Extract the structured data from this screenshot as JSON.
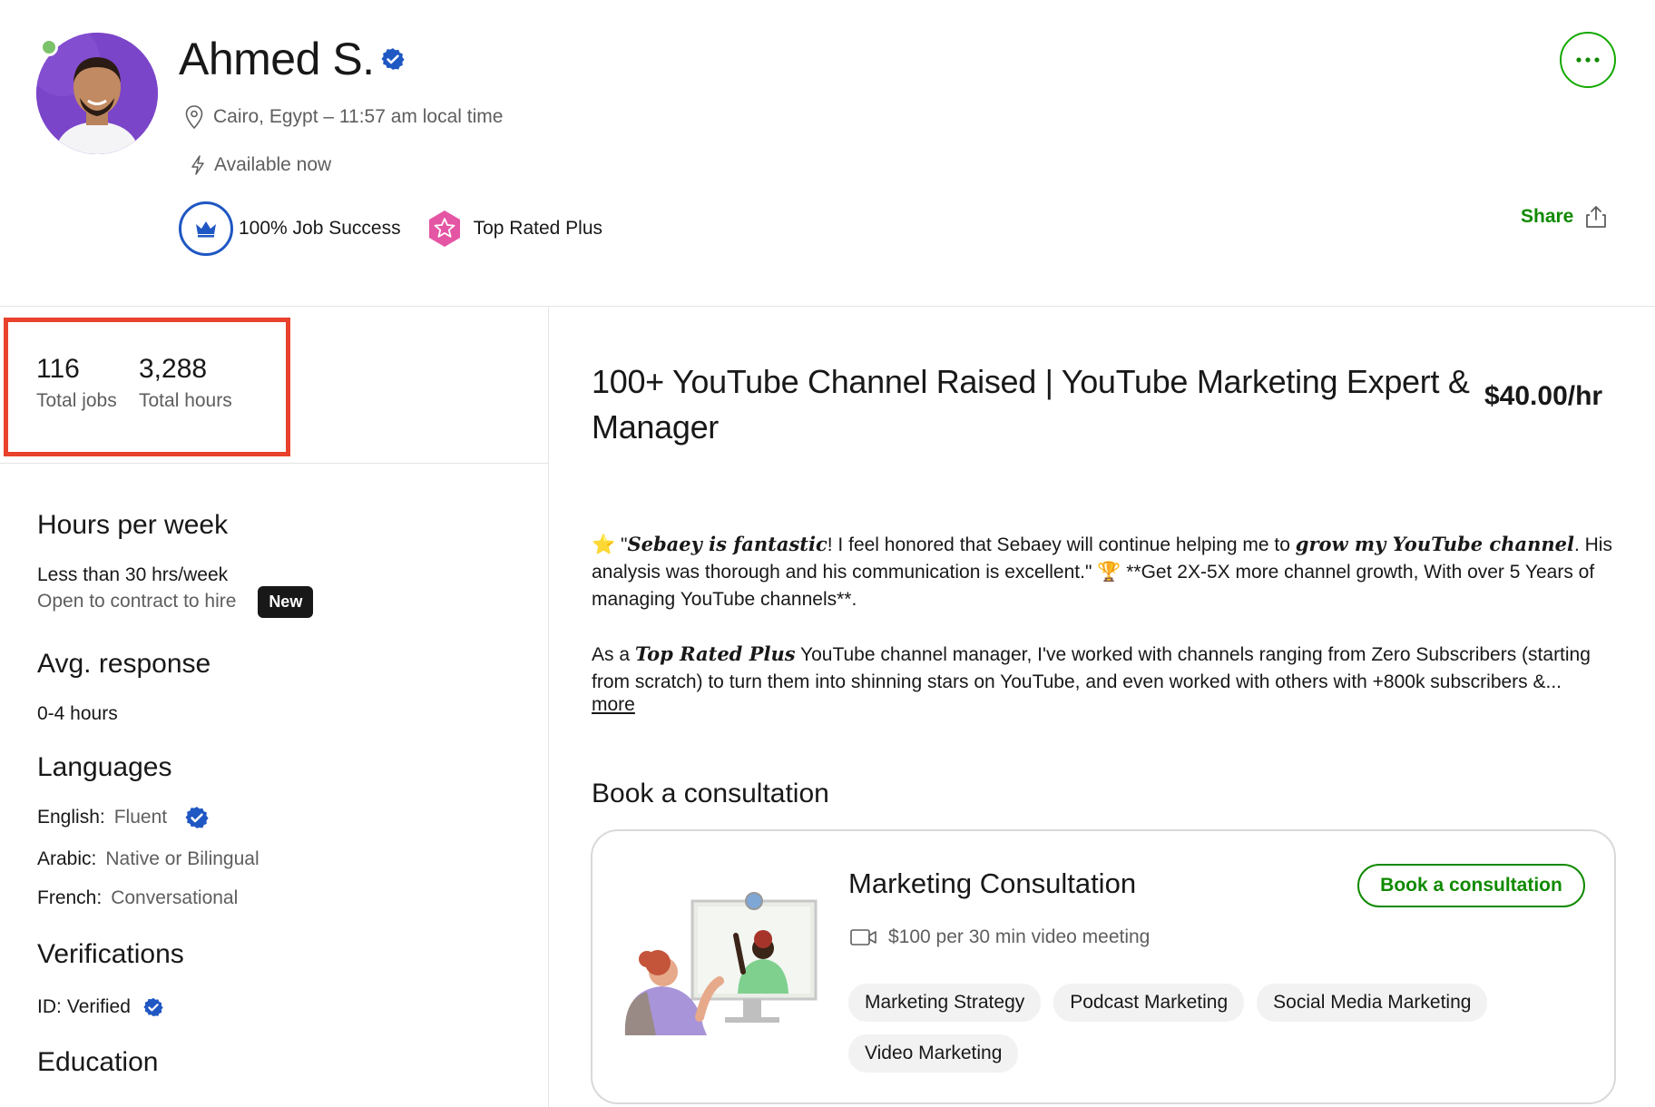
{
  "profile": {
    "name": "Ahmed S.",
    "location": "Cairo, Egypt – 11:57 am local time",
    "availability": "Available now",
    "job_success": "100% Job Success",
    "top_rated": "Top Rated Plus",
    "share_label": "Share"
  },
  "stats": {
    "jobs_value": "116",
    "jobs_label": "Total jobs",
    "hours_value": "3,288",
    "hours_label": "Total hours"
  },
  "sidebar": {
    "hours_heading": "Hours per week",
    "hours_value": "Less than 30 hrs/week",
    "contract_to_hire": "Open to contract to hire",
    "new_badge": "New",
    "response_heading": "Avg. response",
    "response_value": "0-4 hours",
    "languages_heading": "Languages",
    "languages": [
      {
        "name": "English:",
        "level": "Fluent"
      },
      {
        "name": "Arabic:",
        "level": "Native or Bilingual"
      },
      {
        "name": "French:",
        "level": "Conversational"
      }
    ],
    "verifications_heading": "Verifications",
    "id_label": "ID:",
    "id_value": "Verified",
    "education_heading": "Education"
  },
  "main": {
    "title": "100+ YouTube Channel Raised | YouTube Marketing Expert & Manager",
    "rate": "$40.00/hr",
    "desc_p1_a": " \"",
    "desc_p1_it1": "Sebaey is fantastic",
    "desc_p1_b": "! I feel honored that Sebaey will continue helping me to ",
    "desc_p1_it2": "grow my YouTube channel",
    "desc_p1_c": ". His analysis was thorough and his communication is excellent.\" ",
    "desc_p1_d": " **Get 2X-5X more channel growth, With over 5 Years of managing YouTube channels**.",
    "desc_p2_a": "As a ",
    "desc_p2_it": "Top Rated Plus",
    "desc_p2_b": " YouTube channel manager, I've worked with channels ranging from Zero Subscribers (starting from scratch) to turn them into shinning stars on YouTube, and even worked with others with +800k subscribers &...",
    "more_link": "more",
    "book_heading": "Book a consultation",
    "consultation": {
      "title": "Marketing Consultation",
      "meta": "$100 per 30 min video meeting",
      "button": "Book a consultation",
      "skills": [
        "Marketing Strategy",
        "Podcast Marketing",
        "Social Media Marketing",
        "Video Marketing"
      ]
    }
  },
  "colors": {
    "accent_green": "#108a00",
    "verified_blue": "#1f57c3",
    "highlight_red": "#e8412c"
  },
  "icons": [
    "verified-badge-icon",
    "location-pin-icon",
    "lightning-icon",
    "crown-icon",
    "star-badge-icon",
    "ellipsis-icon",
    "share-icon",
    "star-emoji-icon",
    "trophy-emoji-icon",
    "video-camera-icon"
  ]
}
